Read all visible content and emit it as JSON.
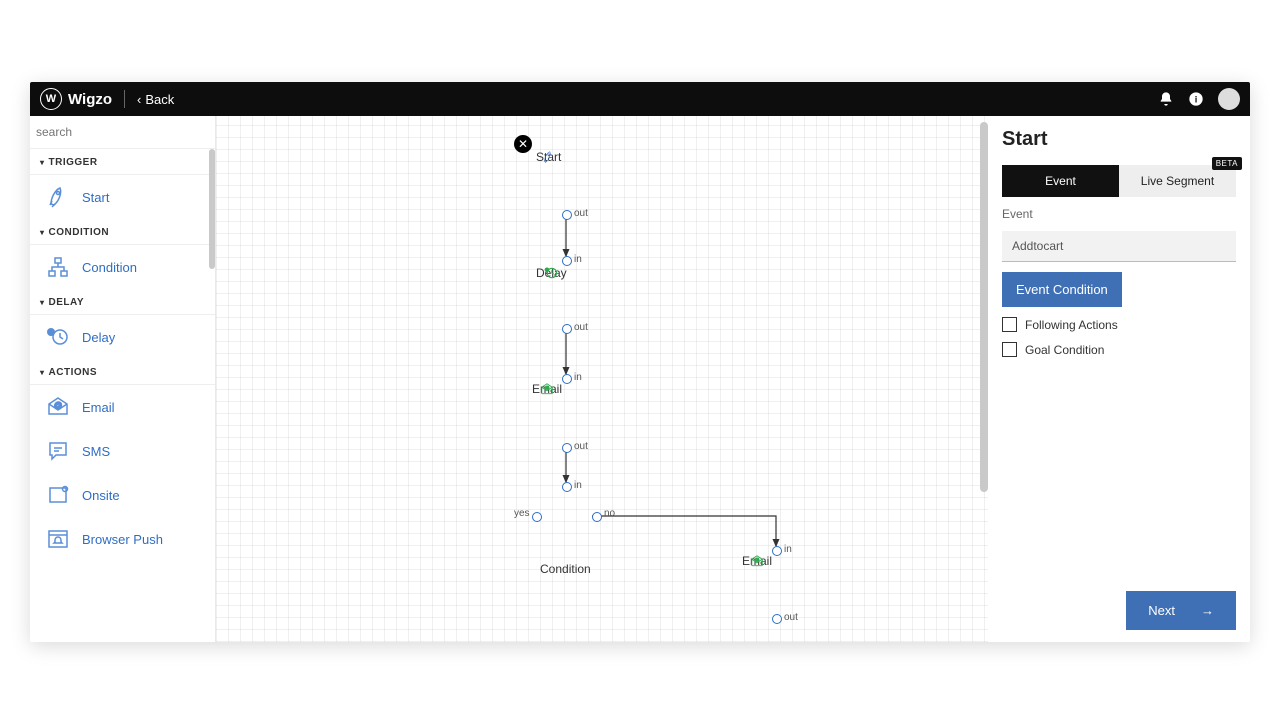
{
  "header": {
    "brand": "Wigzo",
    "back": "Back"
  },
  "sidebar": {
    "search_placeholder": "search",
    "sections": {
      "trigger": {
        "title": "TRIGGER",
        "items": {
          "start": "Start"
        }
      },
      "condition": {
        "title": "CONDITION",
        "items": {
          "condition": "Condition"
        }
      },
      "delay": {
        "title": "DELAY",
        "items": {
          "delay": "Delay"
        }
      },
      "actions": {
        "title": "ACTIONS",
        "items": {
          "email": "Email",
          "sms": "SMS",
          "onsite": "Onsite",
          "browser_push": "Browser Push"
        }
      }
    }
  },
  "canvas": {
    "ports": {
      "in": "in",
      "out": "out",
      "yes": "yes",
      "no": "no"
    },
    "nodes": {
      "start": "Start",
      "delay": "Delay",
      "email1": "Email",
      "condition": "Condition",
      "email2": "Email"
    }
  },
  "panel": {
    "title": "Start",
    "tabs": {
      "event": "Event",
      "live_segment": "Live Segment",
      "beta": "BETA"
    },
    "event_label": "Event",
    "event_value": "Addtocart",
    "event_condition_btn": "Event Condition",
    "following_actions": "Following Actions",
    "goal_condition": "Goal Condition",
    "next": "Next"
  }
}
